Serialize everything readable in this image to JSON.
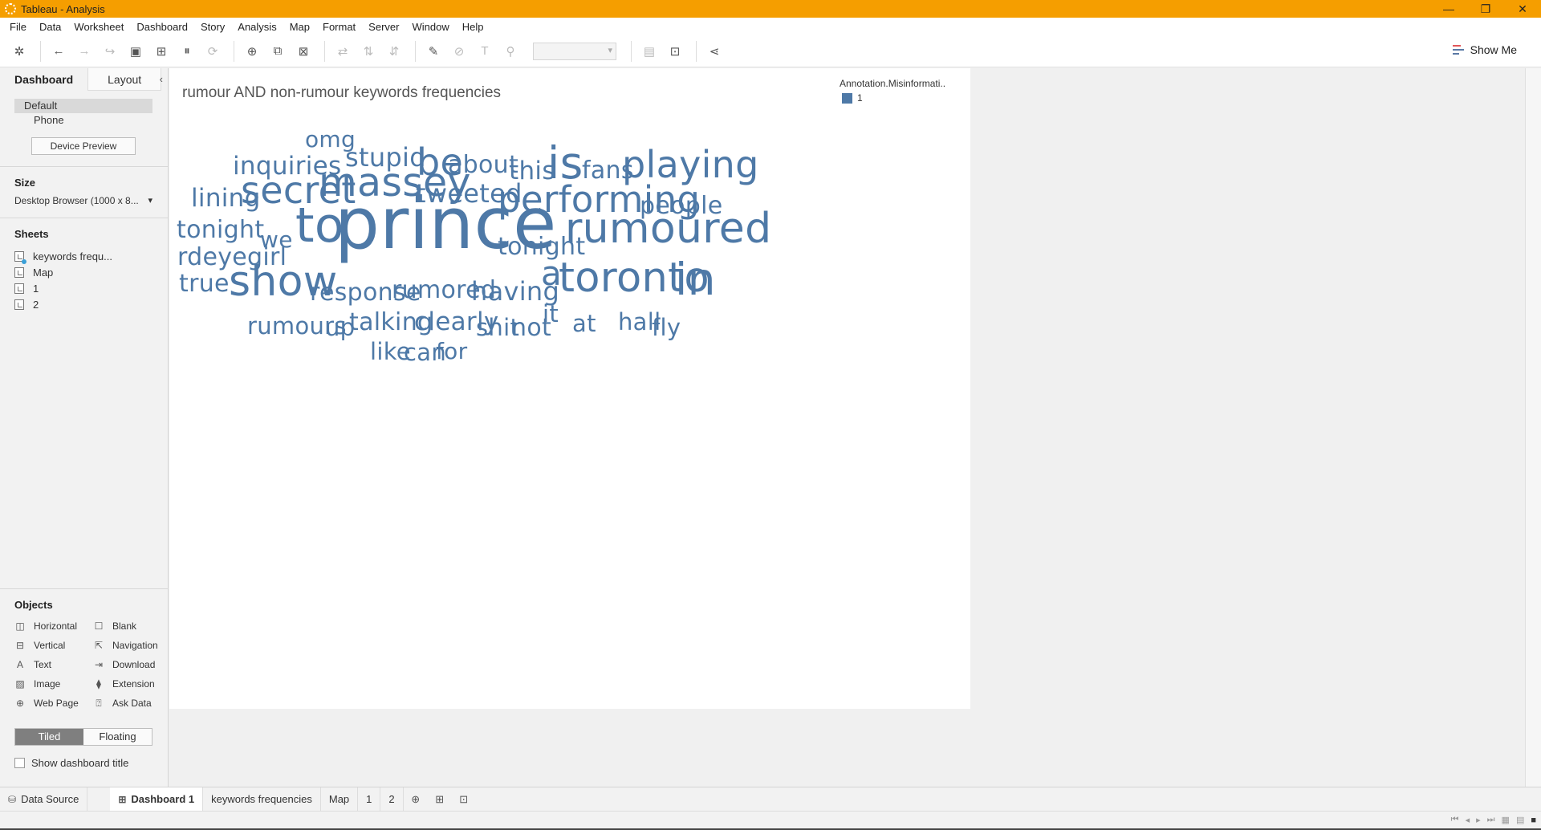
{
  "window": {
    "title": "Tableau - Analysis"
  },
  "menu": [
    "File",
    "Data",
    "Worksheet",
    "Dashboard",
    "Story",
    "Analysis",
    "Map",
    "Format",
    "Server",
    "Window",
    "Help"
  ],
  "toolbar": {
    "show_me_label": "Show Me"
  },
  "left_panel": {
    "tab_dashboard": "Dashboard",
    "tab_layout": "Layout",
    "device_default": "Default",
    "device_phone": "Phone",
    "device_preview": "Device Preview",
    "size_title": "Size",
    "size_value": "Desktop Browser (1000 x 8...",
    "sheets_title": "Sheets",
    "sheets": [
      "keywords frequ...",
      "Map",
      "1",
      "2"
    ],
    "objects_title": "Objects",
    "objects": [
      "Horizontal",
      "Blank",
      "Vertical",
      "Navigation",
      "Text",
      "Download",
      "Image",
      "Extension",
      "Web Page",
      "Ask Data"
    ],
    "tiled": "Tiled",
    "floating": "Floating",
    "show_title": "Show dashboard title"
  },
  "dashboard": {
    "title": "rumour AND non-rumour keywords frequencies",
    "legend_title": "Annotation.Misinformati..",
    "legend_item": "1",
    "color": "#4e79a7"
  },
  "chart_data": {
    "type": "wordcloud",
    "title": "rumour AND non-rumour keywords frequencies",
    "legend": {
      "title": "Annotation.Misinformati..",
      "items": [
        "1"
      ]
    },
    "words": [
      "omg",
      "inquiries",
      "stupid",
      "be",
      "about",
      "this",
      "is",
      "fans",
      "playing",
      "lining",
      "secret",
      "massey",
      "tweeted",
      "performing",
      "people",
      "tonight",
      "we",
      "to",
      "prince",
      "tonight",
      "rumoured",
      "rdeyegirl",
      "true",
      "show",
      "response",
      "rumored",
      "having",
      "a",
      "toronto",
      "in",
      "it",
      "rumours",
      "up",
      "talking",
      "clearly",
      "shit",
      "not",
      "at",
      "hall",
      "fly",
      "like",
      "can",
      "for"
    ]
  },
  "sheet_tabs": {
    "data_source": "Data Source",
    "dashboard1": "Dashboard 1",
    "keywords": "keywords frequencies",
    "map": "Map",
    "s1": "1",
    "s2": "2"
  }
}
